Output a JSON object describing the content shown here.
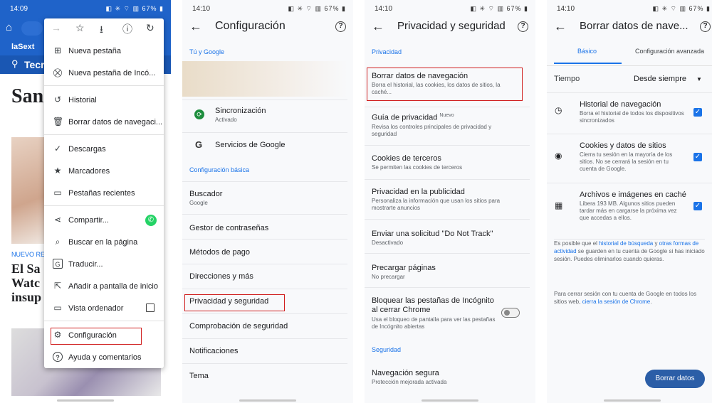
{
  "panel1": {
    "status_time": "14:09",
    "status_icons": "◧ ✳ ⌔ ▥ 67% ▮",
    "site_logo": "laSext",
    "site_name": "Tecr",
    "headline_big": "San",
    "tag": "NUEVO RE",
    "article_lines": [
      "El Sa",
      "Watc",
      "insup"
    ],
    "menu": [
      {
        "icon": "plus-square-icon",
        "glyph": "⊞",
        "label": "Nueva pestaña"
      },
      {
        "icon": "incognito-icon",
        "glyph": "⛒",
        "label": "Nueva pestaña de Incó..."
      },
      {
        "icon": "history-icon",
        "glyph": "↺",
        "label": "Historial"
      },
      {
        "icon": "trash-icon",
        "glyph": "🗑",
        "label": "Borrar datos de navegaci..."
      },
      {
        "icon": "download-check-icon",
        "glyph": "✓",
        "label": "Descargas"
      },
      {
        "icon": "star-icon",
        "glyph": "★",
        "label": "Marcadores"
      },
      {
        "icon": "recent-tabs-icon",
        "glyph": "▭",
        "label": "Pestañas recientes"
      },
      {
        "icon": "share-icon",
        "glyph": "⋖",
        "label": "Compartir..."
      },
      {
        "icon": "find-in-page-icon",
        "glyph": "⌕",
        "label": "Buscar en la página"
      },
      {
        "icon": "translate-icon",
        "glyph": "G",
        "label": "Traducir..."
      },
      {
        "icon": "add-home-icon",
        "glyph": "⇱",
        "label": "Añadir a pantalla de inicio"
      },
      {
        "icon": "desktop-icon",
        "glyph": "▭",
        "label": "Vista ordenador"
      },
      {
        "icon": "gear-icon",
        "glyph": "⚙",
        "label": "Configuración"
      },
      {
        "icon": "help-icon",
        "glyph": "?",
        "label": "Ayuda y comentarios"
      }
    ]
  },
  "panel2": {
    "status_time": "14:10",
    "status_icons": "◧ ✳ ⌔ ▥ 67% ▮",
    "title": "Configuración",
    "sec_you": "Tú y Google",
    "sync_title": "Sincronización",
    "sync_sub": "Activado",
    "google_services": "Servicios de Google",
    "sec_basic": "Configuración básica",
    "search_title": "Buscador",
    "search_sub": "Google",
    "items": [
      "Gestor de contraseñas",
      "Métodos de pago",
      "Direcciones y más",
      "Privacidad y seguridad",
      "Comprobación de seguridad",
      "Notificaciones",
      "Tema"
    ]
  },
  "panel3": {
    "status_time": "14:10",
    "status_icons": "◧ ✳ ⌔ ▥ 67% ▮",
    "title": "Privacidad y seguridad",
    "sec_privacy": "Privacidad",
    "clear_title": "Borrar datos de navegación",
    "clear_sub": "Borra el historial, las cookies, los datos de sitios, la caché...",
    "guide_title": "Guía de privacidad",
    "guide_badge": "Nuevo",
    "guide_sub": "Revisa los controles principales de privacidad y seguridad",
    "cookies_title": "Cookies de terceros",
    "cookies_sub": "Se permiten las cookies de terceros",
    "ads_title": "Privacidad en la publicidad",
    "ads_sub": "Personaliza la información que usan los sitios para mostrarte anuncios",
    "dnt_title": "Enviar una solicitud \"Do Not Track\"",
    "dnt_sub": "Desactivado",
    "preload_title": "Precargar páginas",
    "preload_sub": "No precargar",
    "lock_title": "Bloquear las pestañas de Incógnito al cerrar Chrome",
    "lock_sub": "Usa el bloqueo de pantalla para ver las pestañas de Incógnito abiertas",
    "sec_security": "Seguridad",
    "safe_title": "Navegación segura",
    "safe_sub": "Protección mejorada activada"
  },
  "panel4": {
    "status_time": "14:10",
    "status_icons": "◧ ✳ ⌔ ▥ 67% ▮",
    "title": "Borrar datos de nave...",
    "tab_basic": "Básico",
    "tab_advanced": "Configuración avanzada",
    "time_label": "Tiempo",
    "time_value": "Desde siempre",
    "hist_title": "Historial de navegación",
    "hist_sub": "Borra el historial de todos los dispositivos sincronizados",
    "cookies_title": "Cookies y datos de sitios",
    "cookies_sub": "Cierra tu sesión en la mayoría de los sitios. No se cerrará la sesión en tu cuenta de Google.",
    "cache_title": "Archivos e imágenes en caché",
    "cache_sub": "Libera 193 MB. Algunos sitios pueden tardar más en cargarse la próxima vez que accedas a ellos.",
    "note1_a": "Es posible que el ",
    "note1_link1": "historial de búsqueda",
    "note1_b": " y ",
    "note1_link2": "otras formas de actividad",
    "note1_c": " se guarden en tu cuenta de Google si has iniciado sesión. Puedes eliminarlos cuando quieras.",
    "note2_a": "Para cerrar sesión con tu cuenta de Google en todos los sitios web, ",
    "note2_link": "cierra la sesión de Chrome",
    "note2_b": ".",
    "button": "Borrar datos"
  }
}
